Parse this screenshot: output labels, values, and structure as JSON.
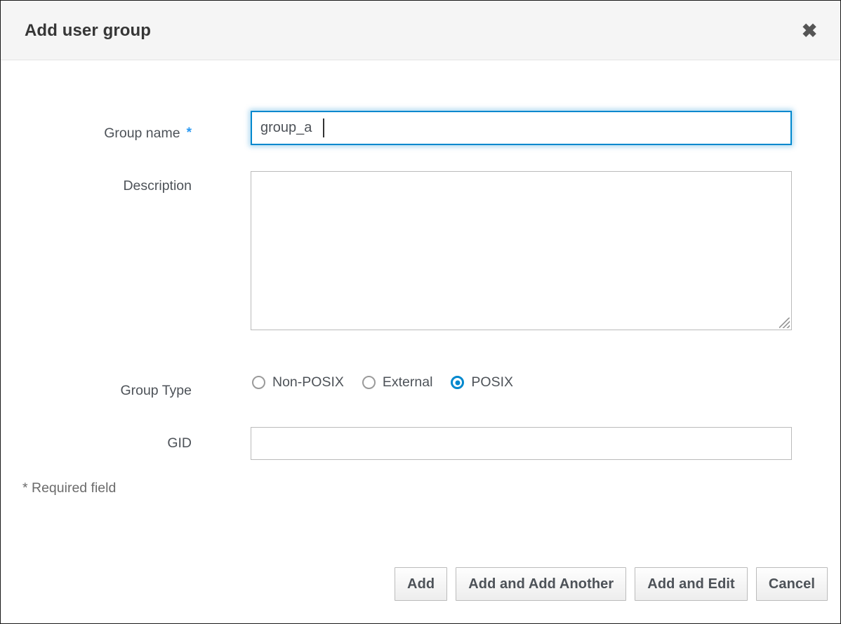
{
  "dialog": {
    "title": "Add user group",
    "close_icon": "close-icon",
    "close_glyph": "✖"
  },
  "form": {
    "group_name": {
      "label": "Group name",
      "required_marker": "*",
      "value": "group_a",
      "placeholder": ""
    },
    "description": {
      "label": "Description",
      "value": "",
      "placeholder": ""
    },
    "group_type": {
      "label": "Group Type",
      "options": [
        {
          "label": "Non-POSIX",
          "selected": false
        },
        {
          "label": "External",
          "selected": false
        },
        {
          "label": "POSIX",
          "selected": true
        }
      ],
      "selected_value": "POSIX"
    },
    "gid": {
      "label": "GID",
      "value": "",
      "placeholder": ""
    },
    "required_note": "* Required field"
  },
  "buttons": {
    "add": "Add",
    "add_and_add_another": "Add and Add Another",
    "add_and_edit": "Add and Edit",
    "cancel": "Cancel"
  },
  "colors": {
    "accent": "#0088ce",
    "required_star": "#2b9af3",
    "header_bg": "#f5f5f5",
    "label_text": "#4d5258",
    "border": "#bbbbbb"
  }
}
